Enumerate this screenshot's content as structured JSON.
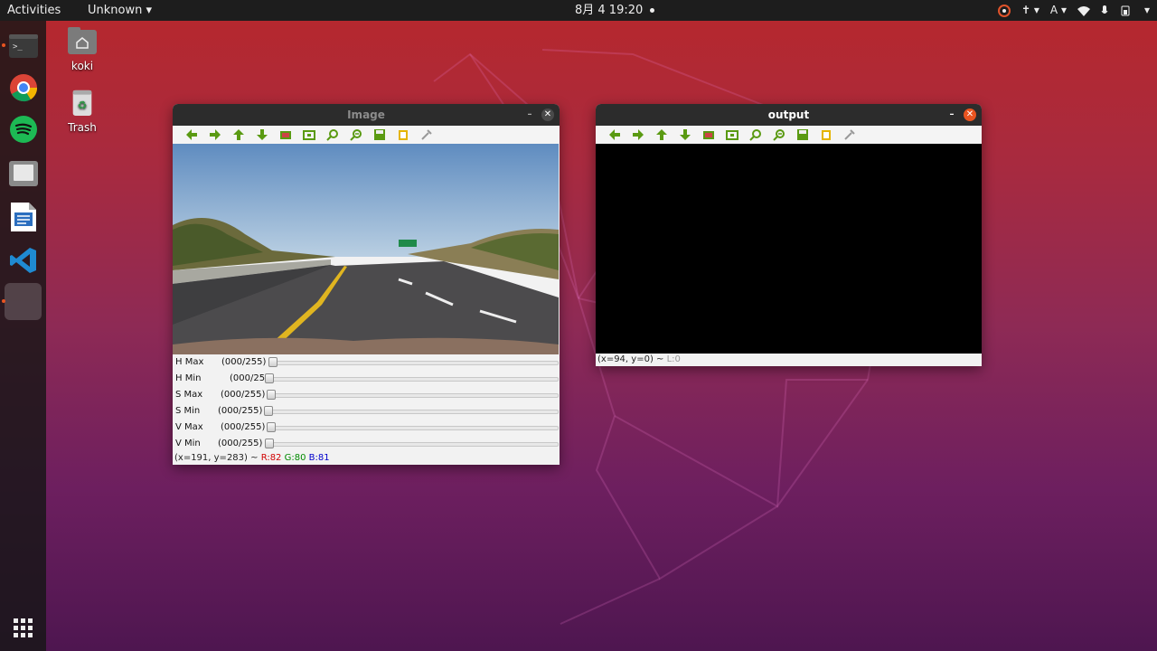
{
  "topbar": {
    "activities": "Activities",
    "app_menu": "Unknown",
    "clock": "8月 4  19:20",
    "input_method": "A"
  },
  "desktop": {
    "icons": [
      {
        "label": "koki",
        "icon": "home-folder-icon"
      },
      {
        "label": "Trash",
        "icon": "trash-icon"
      }
    ]
  },
  "dock": {
    "items": [
      "terminal-icon",
      "chrome-icon",
      "spotify-icon",
      "files-icon",
      "writer-icon",
      "vscode-icon",
      "active-app"
    ],
    "show_apps": "show-apps-icon"
  },
  "image_window": {
    "title": "Image",
    "toolbar": [
      "arrow-left-icon",
      "arrow-right-icon",
      "arrow-up-icon",
      "arrow-down-icon",
      "fit-image-icon",
      "zoom-fit-icon",
      "zoom-in-icon",
      "zoom-out-icon",
      "save-icon",
      "copy-icon",
      "properties-icon"
    ],
    "trackbars": [
      {
        "name": "H Max",
        "value": "(000/255)",
        "level": 0
      },
      {
        "name": "H Min",
        "value": "(000/255)",
        "level": 0
      },
      {
        "name": "S Max",
        "value": "(000/255)",
        "level": 0
      },
      {
        "name": "S Min",
        "value": "(000/255)",
        "level": 0
      },
      {
        "name": "V Max",
        "value": "(000/255)",
        "level": 0
      },
      {
        "name": "V Min",
        "value": "(000/255)",
        "level": 0
      }
    ],
    "status": {
      "coords": "(x=191, y=283) ~",
      "r": "R:82",
      "g": "G:80",
      "b": "B:81"
    }
  },
  "output_window": {
    "title": "output",
    "status": {
      "coords": "(x=94, y=0) ~",
      "l": "L:0"
    }
  },
  "colors": {
    "accent": "#e95420",
    "toolbar_icon": "#5a9a12",
    "r": "#d00000",
    "g": "#008a00",
    "b": "#0000cc",
    "l": "#999999"
  }
}
